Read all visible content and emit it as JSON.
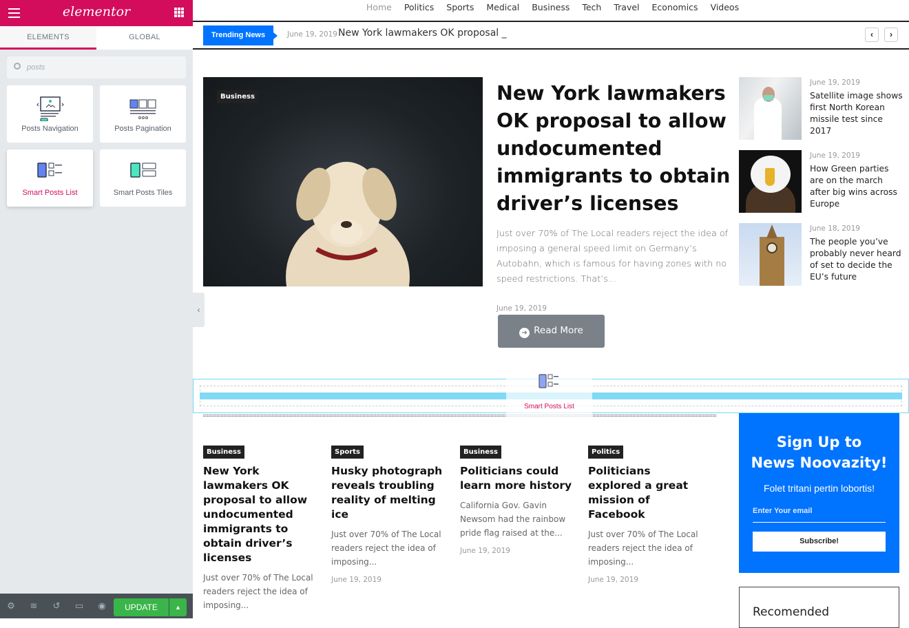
{
  "sidebar": {
    "logo": "elementor",
    "tabs": [
      "ELEMENTS",
      "GLOBAL"
    ],
    "search_value": "posts",
    "widgets": [
      {
        "label": "Posts Navigation",
        "icon": "posts-navigation-icon"
      },
      {
        "label": "Posts Pagination",
        "icon": "posts-pagination-icon"
      },
      {
        "label": "Smart Posts List",
        "icon": "smart-posts-list-icon"
      },
      {
        "label": "Smart Posts Tiles",
        "icon": "smart-posts-tiles-icon"
      }
    ],
    "footer": {
      "update_label": "UPDATE"
    }
  },
  "colors": {
    "elementor": "#d30c5c",
    "accent": "#0073ff",
    "update": "#39b54a",
    "dropzone": "#80d9f5"
  },
  "nav": [
    "Home",
    "Politics",
    "Sports",
    "Medical",
    "Business",
    "Tech",
    "Travel",
    "Economics",
    "Videos"
  ],
  "ticker": {
    "label": "Trending News",
    "date": "June 19, 2019",
    "headline": "New York lawmakers OK proposal _"
  },
  "hero": {
    "category": "Business",
    "title": "New York lawmakers OK proposal to allow undocumented immigrants to obtain driver’s licenses",
    "excerpt": "Just over 70% of The Local readers reject the idea of imposing a general speed limit on Germany’s Autobahn, which is famous for having zones with no speed restrictions. That’s...",
    "date": "June 19, 2019",
    "button": "Read More"
  },
  "side_posts": [
    {
      "date": "June 19, 2019",
      "title": "Satellite image shows first North Korean missile test since 2017"
    },
    {
      "date": "June 19, 2019",
      "title": "How Green parties are on the march after big wins across Europe"
    },
    {
      "date": "June 18, 2019",
      "title": "The people you’ve probably never heard of set to decide the EU’s future"
    }
  ],
  "drag": {
    "label": "Smart Posts List"
  },
  "cards": [
    {
      "category": "Business",
      "title": "New York lawmakers OK proposal to allow undocumented immigrants to obtain driver’s licenses",
      "excerpt": "Just over 70% of The Local readers reject the idea of imposing...",
      "date": ""
    },
    {
      "category": "Sports",
      "title": "Husky photograph reveals troubling reality of melting ice",
      "excerpt": "Just over 70% of The Local readers reject the idea of imposing...",
      "date": "June 19, 2019"
    },
    {
      "category": "Business",
      "title": "Politicians could learn more history",
      "excerpt": "California Gov. Gavin Newsom had the rainbow pride flag raised at the...",
      "date": "June 19, 2019"
    },
    {
      "category": "Politics",
      "title": "Politicians explored a great mission of Facebook",
      "excerpt": "Just over 70% of The Local readers reject the idea of imposing...",
      "date": "June 19, 2019"
    }
  ],
  "signup": {
    "title_line1": "Sign Up to",
    "title_line2": "News Noovazity!",
    "subtitle": "Folet tritani pertin lobortis!",
    "email_placeholder": "Enter Your email",
    "button": "Subscribe!"
  },
  "recommended": {
    "title": "Recomended"
  }
}
